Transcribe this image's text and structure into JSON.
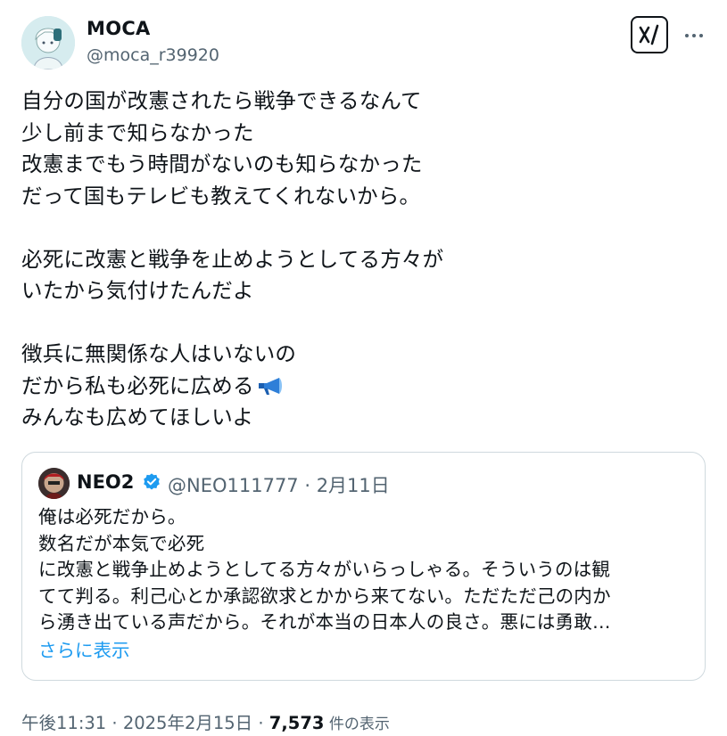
{
  "author": {
    "display_name": "MOCA",
    "handle": "@moca_r39920"
  },
  "tweet": {
    "lines": [
      "自分の国が改憲されたら戦争できるなんて",
      "少し前まで知らなかった",
      "改憲までもう時間がないのも知らなかった",
      "だって国もテレビも教えてくれないから。",
      "",
      "必死に改憲と戦争を止めようとしてる方々が",
      "いたから気付けたんだよ",
      "",
      "徴兵に無関係な人はいないの",
      "だから私も必死に広める",
      "みんなも広めてほしいよ"
    ]
  },
  "quote": {
    "name": "NEO2",
    "meta": "@NEO111777 · 2月11日",
    "lines": [
      "俺は必死だから。",
      "数名だが本気で必死",
      "に改憲と戦争止めようとしてる方々がいらっしゃる。そういうのは観",
      "てて判る。利己心とか承認欲求とかから来てない。ただただ己の内か",
      "ら湧き出ている声だから。それが本当の日本人の良さ。悪には勇敢…"
    ],
    "show_more": "さらに表示"
  },
  "footer": {
    "time": "午後11:31",
    "sep1": " · ",
    "date": "2025年2月15日",
    "sep2": " · ",
    "views": "7,573",
    "views_label": " 件の表示"
  },
  "icons": {
    "grok": "grok-icon",
    "more": "more-icon",
    "verified": "verified-badge-icon",
    "megaphone": "megaphone-icon"
  },
  "colors": {
    "text": "#0f1419",
    "secondary": "#536471",
    "link": "#1d9bf0",
    "border": "#cfd9de"
  }
}
